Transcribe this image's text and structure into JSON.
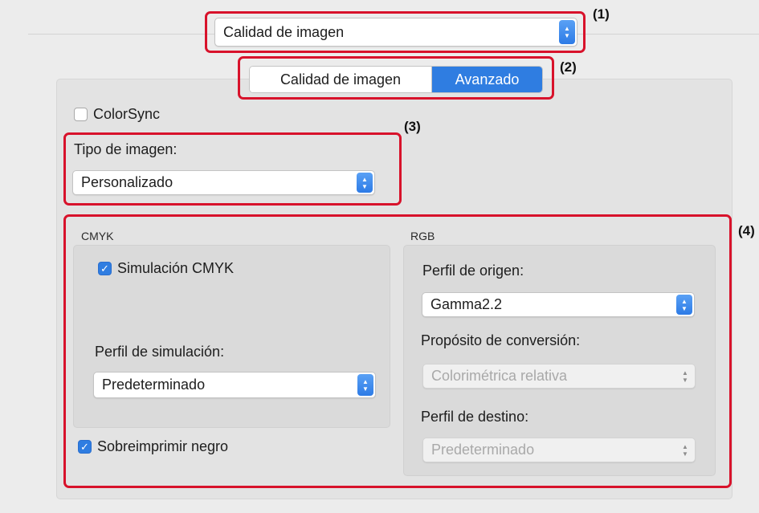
{
  "preset_menu": {
    "value": "Calidad de imagen"
  },
  "segmented": {
    "tab_quality": "Calidad de imagen",
    "tab_advanced": "Avanzado",
    "selected": "Avanzado"
  },
  "colorsync": {
    "label": "ColorSync",
    "checked": false
  },
  "image_type": {
    "label": "Tipo de imagen:",
    "value": "Personalizado"
  },
  "cmyk": {
    "title": "CMYK",
    "simulation_label": "Simulación CMYK",
    "simulation_checked": true,
    "profile_label": "Perfil de simulación:",
    "profile_value": "Predeterminado"
  },
  "overprint": {
    "label": "Sobreimprimir negro",
    "checked": true
  },
  "rgb": {
    "title": "RGB",
    "source_label": "Perfil de origen:",
    "source_value": "Gamma2.2",
    "intent_label": "Propósito de conversión:",
    "intent_value": "Colorimétrica relativa",
    "dest_label": "Perfil de destino:",
    "dest_value": "Predeterminado"
  },
  "callouts": {
    "c1": "(1)",
    "c2": "(2)",
    "c3": "(3)",
    "c4": "(4)"
  },
  "colors": {
    "accent": "#2f7de1",
    "annotation": "#d8122b"
  }
}
